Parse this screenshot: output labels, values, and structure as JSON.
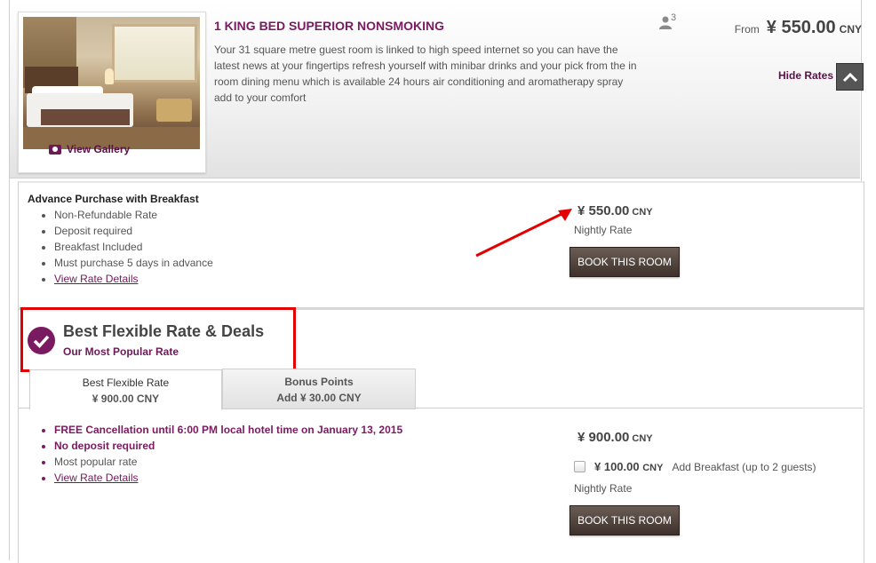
{
  "room": {
    "title": "1 KING BED SUPERIOR NONSMOKING",
    "description": "Your 31 square metre guest room is linked to high speed internet so you can have the latest news at your fingertips refresh yourself with minibar drinks and your pick from the in room dining menu which is available 24 hours air conditioning and aromatherapy spray add to your comfort",
    "guest_count": "3",
    "from_label": "From",
    "from_price": "¥ 550.00",
    "from_currency": "CNY",
    "gallery_label": "View Gallery",
    "hide_rates_label": "Hide Rates"
  },
  "advance_rate": {
    "title": "Advance Purchase with Breakfast",
    "features": [
      "Non-Refundable Rate",
      "Deposit required",
      "Breakfast Included",
      "Must purchase 5 days in advance"
    ],
    "details_link": "View Rate Details",
    "price": "¥ 550.00",
    "currency": "CNY",
    "nightly_label": "Nightly Rate",
    "book_label": "BOOK THIS ROOM"
  },
  "flexible": {
    "title": "Best Flexible Rate & Deals",
    "subtitle": "Our Most Popular Rate",
    "tabs": [
      {
        "line1": "Best Flexible Rate",
        "line2": "¥ 900.00 CNY"
      },
      {
        "line1": "Bonus Points",
        "line2": "Add  ¥ 30.00 CNY"
      }
    ],
    "features": [
      "FREE Cancellation until 6:00 PM local hotel time on January 13, 2015",
      "No deposit required",
      "Most popular rate"
    ],
    "details_link": "View Rate Details",
    "price": "¥ 900.00",
    "currency": "CNY",
    "addon_price": "¥ 100.00",
    "addon_currency": "CNY",
    "addon_label": "Add Breakfast (up to 2 guests)",
    "nightly_label": "Nightly Rate",
    "book_label": "BOOK THIS ROOM"
  },
  "colors": {
    "accent": "#7a1a60",
    "highlight_box": "#e30000",
    "button": "#4a3d36"
  }
}
